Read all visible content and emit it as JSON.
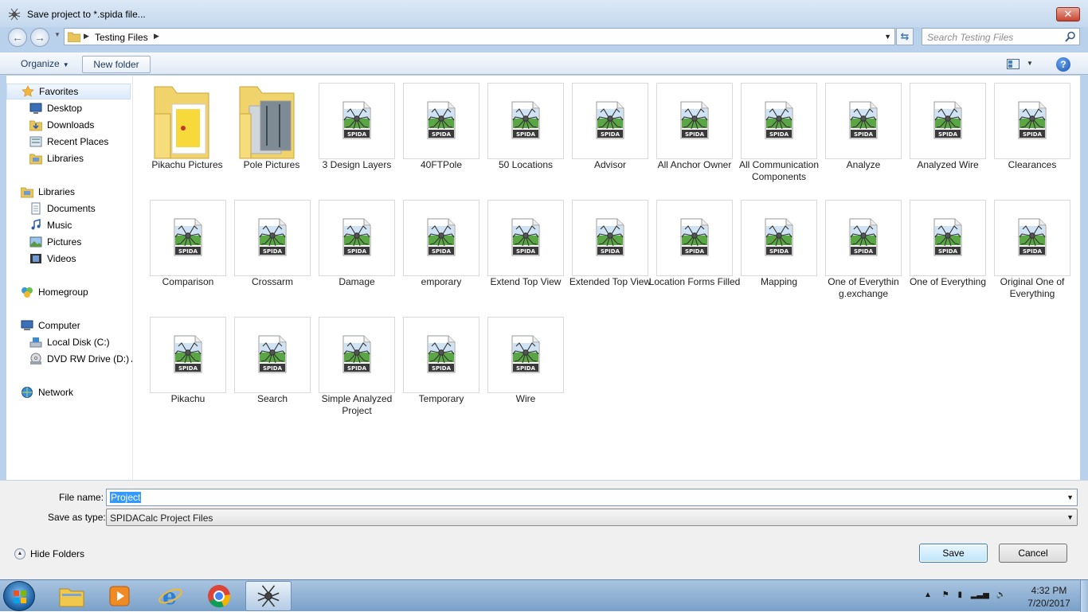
{
  "window": {
    "title": "Save project to *.spida file...",
    "close_label": "✕"
  },
  "address": {
    "crumb": "Testing Files",
    "sep": "▶"
  },
  "search": {
    "placeholder": "Search Testing Files"
  },
  "toolbar": {
    "organize_label": "Organize",
    "new_folder_label": "New folder",
    "help_label": "?"
  },
  "sidebar": {
    "items": [
      {
        "label": "Favorites",
        "icon": "star-icon"
      },
      {
        "label": "Desktop",
        "icon": "desktop-icon"
      },
      {
        "label": "Downloads",
        "icon": "downloads-icon"
      },
      {
        "label": "Recent Places",
        "icon": "recent-places-icon"
      },
      {
        "label": "Libraries",
        "icon": "libraries-icon"
      },
      {
        "label": "Libraries",
        "icon": "libraries-icon"
      },
      {
        "label": "Documents",
        "icon": "documents-icon"
      },
      {
        "label": "Music",
        "icon": "music-icon"
      },
      {
        "label": "Pictures",
        "icon": "pictures-icon"
      },
      {
        "label": "Videos",
        "icon": "videos-icon"
      },
      {
        "label": "Homegroup",
        "icon": "homegroup-icon"
      },
      {
        "label": "Computer",
        "icon": "computer-icon"
      },
      {
        "label": "Local Disk (C:)",
        "icon": "local-disk-icon"
      },
      {
        "label": "DVD RW Drive (D:) A",
        "icon": "dvd-drive-icon"
      },
      {
        "label": "Network",
        "icon": "network-icon"
      }
    ]
  },
  "files": {
    "folders": [
      {
        "name": "Pikachu Pictures"
      },
      {
        "name": "Pole Pictures"
      }
    ],
    "spida_badge": "SPIDA",
    "items": [
      {
        "name": "3 Design Layers"
      },
      {
        "name": "40FTPole"
      },
      {
        "name": "50 Locations"
      },
      {
        "name": "Advisor"
      },
      {
        "name": "All Anchor Owner"
      },
      {
        "name": "All Communication Components"
      },
      {
        "name": "Analyze"
      },
      {
        "name": "Analyzed Wire"
      },
      {
        "name": "Clearances"
      },
      {
        "name": "Comparison"
      },
      {
        "name": "Crossarm"
      },
      {
        "name": "Damage"
      },
      {
        "name": "emporary"
      },
      {
        "name": "Extend Top View"
      },
      {
        "name": "Extended Top View"
      },
      {
        "name": "Location Forms Filled"
      },
      {
        "name": "Mapping"
      },
      {
        "name": "One of Everything.exchange"
      },
      {
        "name": "One of Everything"
      },
      {
        "name": "Original One of Everything"
      },
      {
        "name": "Pikachu"
      },
      {
        "name": "Search"
      },
      {
        "name": "Simple Analyzed Project"
      },
      {
        "name": "Temporary"
      },
      {
        "name": "Wire"
      }
    ]
  },
  "form": {
    "file_name_label": "File name:",
    "file_name_value": "Project",
    "save_type_label": "Save as type:",
    "save_type_value": "SPIDACalc Project Files",
    "hide_folders_label": "Hide Folders",
    "save_label": "Save",
    "cancel_label": "Cancel"
  },
  "taskbar": {
    "apps": [
      "file-explorer-icon",
      "media-player-icon",
      "internet-explorer-icon",
      "chrome-icon",
      "spidacalc-icon"
    ],
    "time": "4:32 PM",
    "date": "7/20/2017",
    "tray_expand": "▲"
  },
  "colors": {
    "accent": "#3399ff",
    "titlebar": "#c4d8ee",
    "spida_green": "#5aa544",
    "folder": "#f2d36b"
  }
}
